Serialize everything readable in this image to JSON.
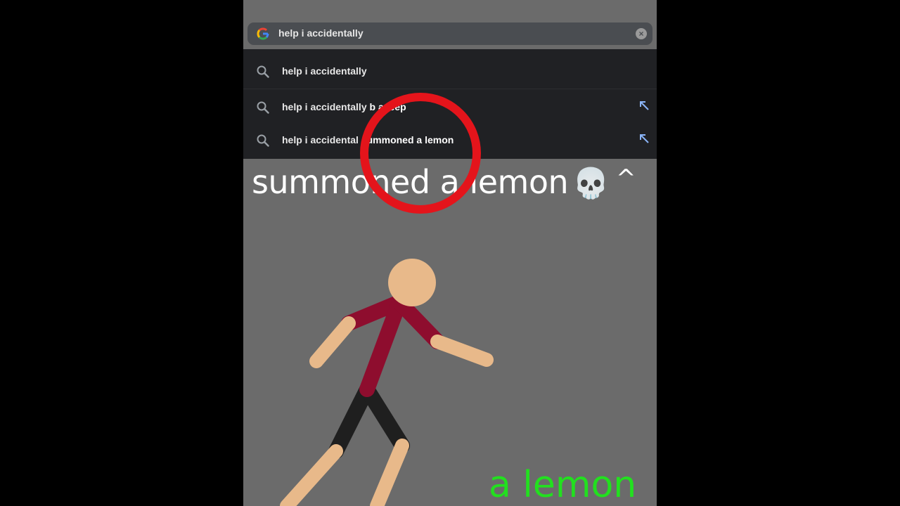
{
  "search": {
    "query": "help i accidentally"
  },
  "suggestions": [
    {
      "prefix": "help i accidentally",
      "completion": ""
    },
    {
      "prefix": "help i accidentally ",
      "completion": "b   a jeep"
    },
    {
      "prefix": "help i accidental   ",
      "completion": "summoned a lemon"
    }
  ],
  "caption": {
    "text": "summoned a lemon",
    "emoji": "💀",
    "caret": "^"
  },
  "overlay_label": "a lemon",
  "icons": {
    "logo": "google-logo-icon",
    "clear": "clear-icon",
    "search": "search-icon",
    "fill": "fill-arrow-icon"
  },
  "colors": {
    "highlight_ring": "#e4141b",
    "label_green": "#22e01f",
    "shirt": "#8e0d2e",
    "skin": "#e8b98a"
  }
}
